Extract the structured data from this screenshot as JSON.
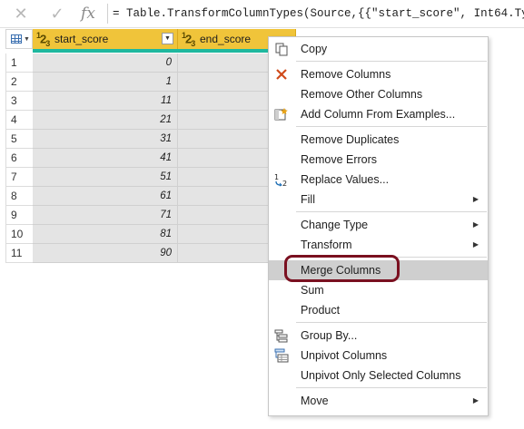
{
  "formula_bar": {
    "cancel_icon": "close-icon",
    "commit_icon": "check-icon",
    "fx_label": "fx",
    "formula": "= Table.TransformColumnTypes(Source,{{\"start_score\", Int64.Type}, {\""
  },
  "grid": {
    "columns": [
      {
        "type_label": "123",
        "name": "start_score"
      },
      {
        "type_label": "123",
        "name": "end_score"
      }
    ],
    "rows": [
      {
        "num": "1",
        "start_score": "0"
      },
      {
        "num": "2",
        "start_score": "1"
      },
      {
        "num": "3",
        "start_score": "11"
      },
      {
        "num": "4",
        "start_score": "21"
      },
      {
        "num": "5",
        "start_score": "31"
      },
      {
        "num": "6",
        "start_score": "41"
      },
      {
        "num": "7",
        "start_score": "51"
      },
      {
        "num": "8",
        "start_score": "61"
      },
      {
        "num": "9",
        "start_score": "71"
      },
      {
        "num": "10",
        "start_score": "81"
      },
      {
        "num": "11",
        "start_score": "90"
      }
    ]
  },
  "context_menu": {
    "items": [
      {
        "label": "Copy",
        "icon": "copy-icon"
      },
      {
        "label": "Remove Columns",
        "icon": "remove-columns-icon"
      },
      {
        "label": "Remove Other Columns",
        "icon": ""
      },
      {
        "label": "Add Column From Examples...",
        "icon": "column-from-examples-icon"
      },
      {
        "label": "Remove Duplicates",
        "icon": ""
      },
      {
        "label": "Remove Errors",
        "icon": ""
      },
      {
        "label": "Replace Values...",
        "icon": "replace-values-icon"
      },
      {
        "label": "Fill",
        "icon": "",
        "submenu": true
      },
      {
        "label": "Change Type",
        "icon": "",
        "submenu": true
      },
      {
        "label": "Transform",
        "icon": "",
        "submenu": true
      },
      {
        "label": "Merge Columns",
        "icon": "",
        "highlighted": true
      },
      {
        "label": "Sum",
        "icon": ""
      },
      {
        "label": "Product",
        "icon": ""
      },
      {
        "label": "Group By...",
        "icon": "group-by-icon"
      },
      {
        "label": "Unpivot Columns",
        "icon": "unpivot-columns-icon"
      },
      {
        "label": "Unpivot Only Selected Columns",
        "icon": ""
      },
      {
        "label": "Move",
        "icon": "",
        "submenu": true
      }
    ]
  },
  "colors": {
    "header_fill": "#f0c43a",
    "quality_bar": "#1fb89f",
    "annotation": "#7a1020",
    "highlight": "#cfcfcf"
  }
}
